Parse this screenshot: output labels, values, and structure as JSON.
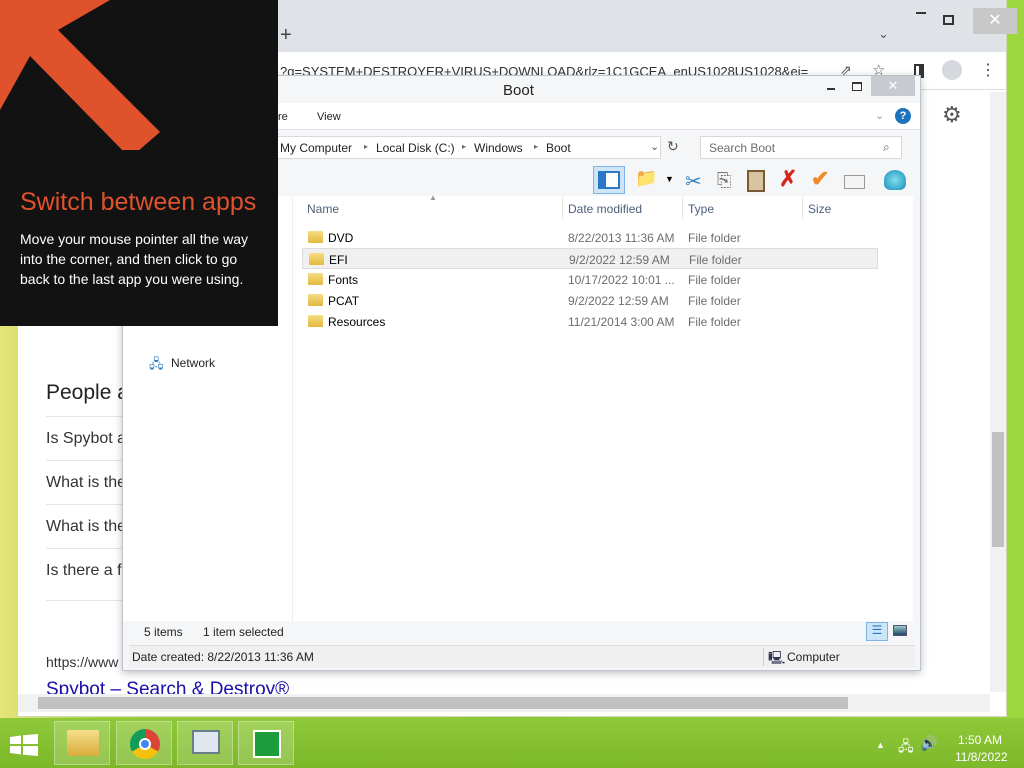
{
  "browser": {
    "url": "?q=SYSTEM+DESTROYER+VIRUS+DOWNLOAD&rlz=1C1GCEA_enUS1028US1028&ei=",
    "new_tab": "+",
    "page": {
      "people_heading": "People a",
      "questions": [
        "Is Spybot a",
        "What is the",
        "What is the",
        "Is there a f"
      ],
      "result_url": "https://www",
      "result_title": "Spybot – Search & Destroy®"
    }
  },
  "explorer": {
    "title": "Boot",
    "ribbon_tabs": [
      "re",
      "View"
    ],
    "breadcrumb": [
      "My Computer",
      "Local Disk (C:)",
      "Windows",
      "Boot"
    ],
    "search_placeholder": "Search Boot",
    "columns": [
      "Name",
      "Date modified",
      "Type",
      "Size"
    ],
    "files": [
      {
        "name": "DVD",
        "date": "8/22/2013 11:36 AM",
        "type": "File folder",
        "selected": false
      },
      {
        "name": "EFI",
        "date": "9/2/2022 12:59 AM",
        "type": "File folder",
        "selected": true
      },
      {
        "name": "Fonts",
        "date": "10/17/2022 10:01 ...",
        "type": "File folder",
        "selected": false
      },
      {
        "name": "PCAT",
        "date": "9/2/2022 12:59 AM",
        "type": "File folder",
        "selected": false
      },
      {
        "name": "Resources",
        "date": "11/21/2014 3:00 AM",
        "type": "File folder",
        "selected": false
      }
    ],
    "nav_network": "Network",
    "status_items": "5 items",
    "status_selected": "1 item selected",
    "details": "Date created: 8/22/2013 11:36 AM",
    "details_location": "Computer"
  },
  "overlay": {
    "title": "Switch between apps",
    "body": "Move your mouse pointer all the way into the corner, and then click to go back to the last app you were using.",
    "accent": "#e0522c"
  },
  "taskbar": {
    "time": "1:50 AM",
    "date": "11/8/2022"
  }
}
